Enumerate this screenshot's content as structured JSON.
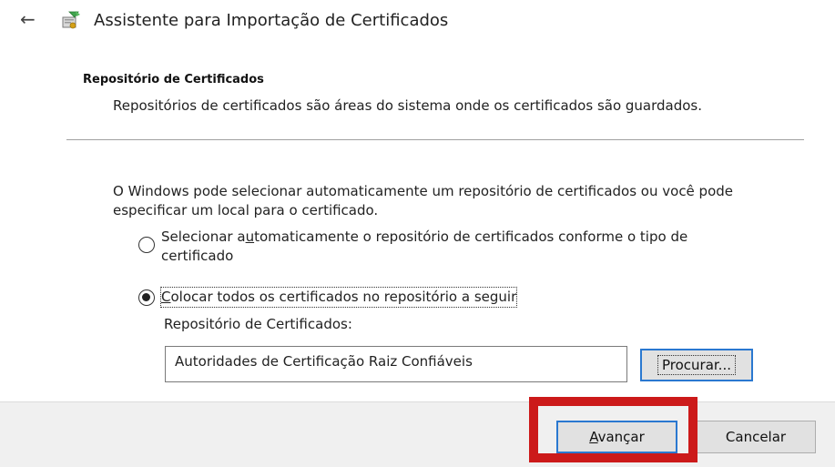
{
  "window": {
    "title": "Assistente para Importação de Certificados"
  },
  "section": {
    "heading": "Repositório de Certificados",
    "description": "Repositórios de certificados são áreas do sistema onde os certificados são guardados."
  },
  "intro": "O Windows pode selecionar automaticamente um repositório de certificados ou você pode especificar um local para o certificado.",
  "options": {
    "auto": {
      "label_pre": "Selecionar a",
      "label_accel": "u",
      "label_post": "tomaticamente o repositório de certificados conforme o tipo de certificado",
      "checked": false
    },
    "manual": {
      "label_accel": "C",
      "label_post": "olocar todos os certificados no repositório a seguir",
      "checked": true
    }
  },
  "store": {
    "label": "Repositório de Certificados:",
    "value": "Autoridades de Certificação Raiz Confiáveis",
    "browse_label": "Procurar..."
  },
  "footer": {
    "next_accel": "A",
    "next_post": "vançar",
    "cancel_label": "Cancelar"
  },
  "colors": {
    "highlight": "#cc1a1a",
    "focus_border": "#2a78d0"
  },
  "icons": {
    "back": "back-arrow-icon",
    "wizard": "certificate-wizard-icon"
  }
}
